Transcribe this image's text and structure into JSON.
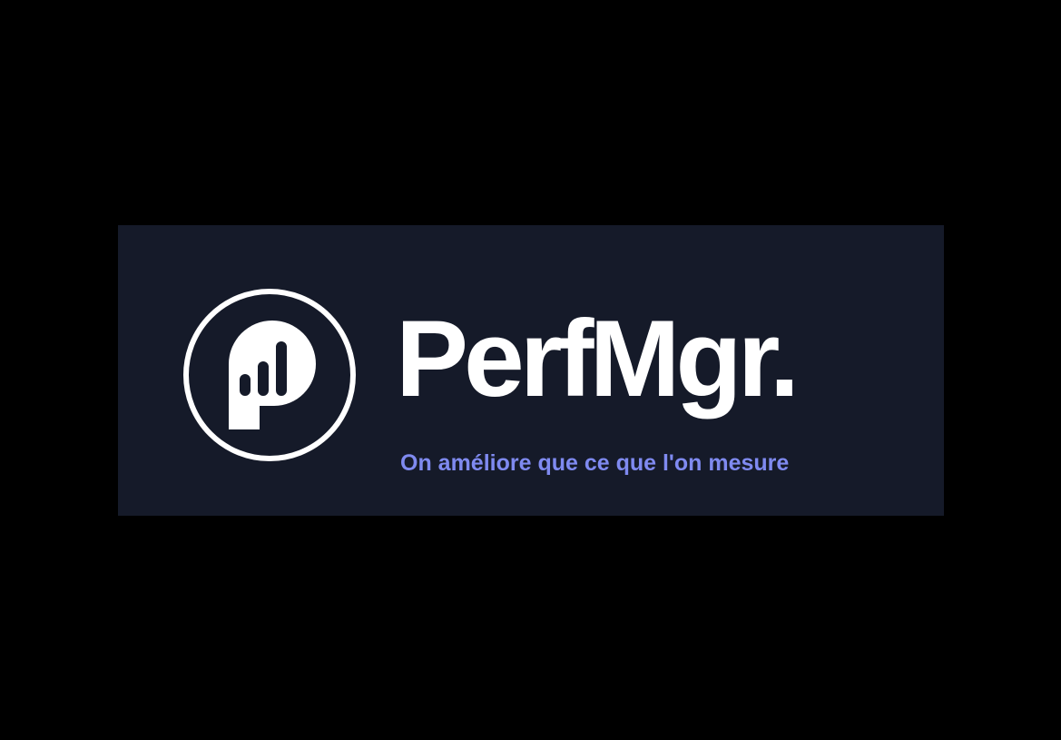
{
  "brand": {
    "name": "PerfMgr.",
    "tagline": "On améliore que ce que l'on mesure",
    "logo_icon": "p-bar-chart-icon"
  },
  "colors": {
    "page_background": "#000000",
    "banner_background": "#151a29",
    "wordmark": "#ffffff",
    "tagline": "#7f8af0"
  }
}
